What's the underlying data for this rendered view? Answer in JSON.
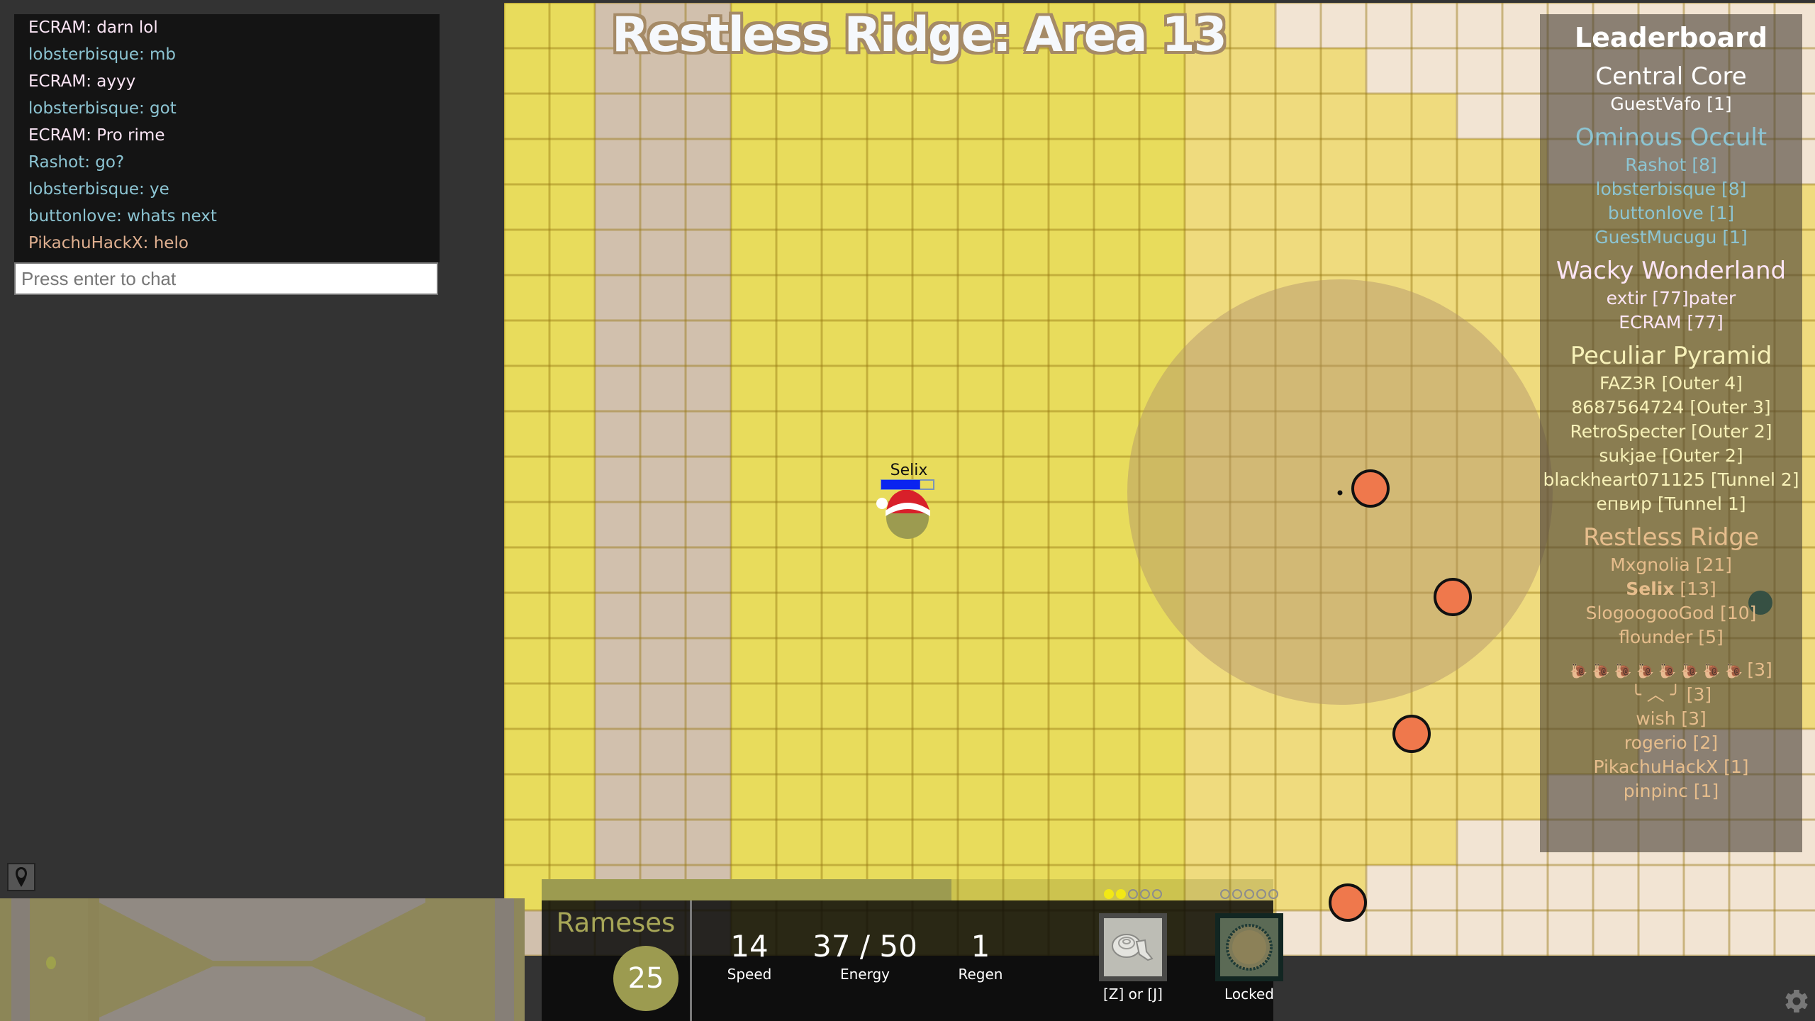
{
  "game": {
    "area_title": "Restless Ridge: Area 13",
    "player": {
      "name": "Selix",
      "energy_fraction": 0.74,
      "hat": "santa-hat"
    },
    "colors": {
      "zone_yellow": "#e8dc5c",
      "zone_light_yellow": "#efdb7e",
      "zone_tan": "#d1c0ad",
      "zone_cream": "#f2e4d3",
      "enemy": "#ef784c",
      "aura": "#b0906a",
      "player_body": "#9c9b50",
      "teal_orb": "#1f6b5a"
    }
  },
  "chat": {
    "messages": [
      {
        "text": "ECRAM: darn lol",
        "color": "#fbe5f5"
      },
      {
        "text": "lobsterbisque: mb",
        "color": "#8cc4d2"
      },
      {
        "text": "ECRAM: ayyy",
        "color": "#fbe5f5"
      },
      {
        "text": "lobsterbisque: got",
        "color": "#8cc4d2"
      },
      {
        "text": "ECRAM: Pro rime",
        "color": "#fbe5f5"
      },
      {
        "text": "Rashot: go?",
        "color": "#8cc4d2"
      },
      {
        "text": "lobsterbisque: ye",
        "color": "#8cc4d2"
      },
      {
        "text": "buttonlove: whats next",
        "color": "#8cc4d2"
      },
      {
        "text": "PikachuHackX: helo",
        "color": "#e0b090"
      }
    ],
    "input_placeholder": "Press enter to chat"
  },
  "leaderboard": {
    "title": "Leaderboard",
    "areas": [
      {
        "name": "Central Core",
        "color": "#ffffff",
        "players": [
          {
            "name": "GuestVafo",
            "level": "[1]"
          }
        ]
      },
      {
        "name": "Ominous Occult",
        "color": "#8cc4d2",
        "players": [
          {
            "name": "Rashot",
            "level": "[8]"
          },
          {
            "name": "lobsterbisque",
            "level": "[8]"
          },
          {
            "name": "buttonlove",
            "level": "[1]"
          },
          {
            "name": "GuestMucugu",
            "level": "[1]"
          }
        ]
      },
      {
        "name": "Wacky Wonderland",
        "color": "#fbe5f5",
        "players": [
          {
            "name": "extir",
            "level": "[77]pater"
          },
          {
            "name": "ECRAM",
            "level": "[77]"
          }
        ]
      },
      {
        "name": "Peculiar Pyramid",
        "color": "#f7f1b8",
        "players": [
          {
            "name": "FAZ3R",
            "level": "[Outer 4]"
          },
          {
            "name": "8687564724",
            "level": "[Outer 3]"
          },
          {
            "name": "RetroSpecter",
            "level": "[Outer 2]"
          },
          {
            "name": "sukjae",
            "level": "[Outer 2]"
          },
          {
            "name": "blackheart071125",
            "level": "[Tunnel 2]"
          },
          {
            "name": "епвир",
            "level": "[Tunnel 1]"
          }
        ]
      },
      {
        "name": "Restless Ridge",
        "color": "#e6bd8c",
        "players": [
          {
            "name": "Mxgnolia",
            "level": "[21]"
          },
          {
            "name": "Selix",
            "level": "[13]",
            "self": true
          },
          {
            "name": "SlogoogooGod",
            "level": "[10]"
          },
          {
            "name": "flounder",
            "level": "[5]"
          }
        ]
      }
    ],
    "extra_players": [
      {
        "name": "🐌 🐌 🐌 🐌 🐌 🐌 🐌 🐌 ",
        "level": "[3]"
      },
      {
        "name": "╰ ︿ ╯ ",
        "level": "[3]"
      },
      {
        "name": "wish",
        "level": "[3]"
      },
      {
        "name": "rogerio",
        "level": "[2]"
      },
      {
        "name": "PikachuHackX",
        "level": "[1]"
      },
      {
        "name": "pinpinc",
        "level": "[1]"
      }
    ],
    "extra_color": "#e6bd8c"
  },
  "hero": {
    "name": "Rameses",
    "level": "25",
    "xp_fraction": 0.56,
    "stats": [
      {
        "value": "14",
        "label": "Speed"
      },
      {
        "value": "37 / 50",
        "label": "Energy"
      },
      {
        "value": "1",
        "label": "Regen"
      }
    ],
    "abilities": [
      {
        "key_label": "[Z] or [J]",
        "upgrade_level": 2,
        "max_level": 5,
        "icon": "snail-shell-icon",
        "locked": false
      },
      {
        "key_label": "Locked",
        "upgrade_level": 0,
        "max_level": 5,
        "icon": "sand-circle-icon",
        "locked": true
      }
    ]
  },
  "controls": {
    "map_pin_icon": "map-pin-icon",
    "settings_icon": "gear-icon"
  }
}
